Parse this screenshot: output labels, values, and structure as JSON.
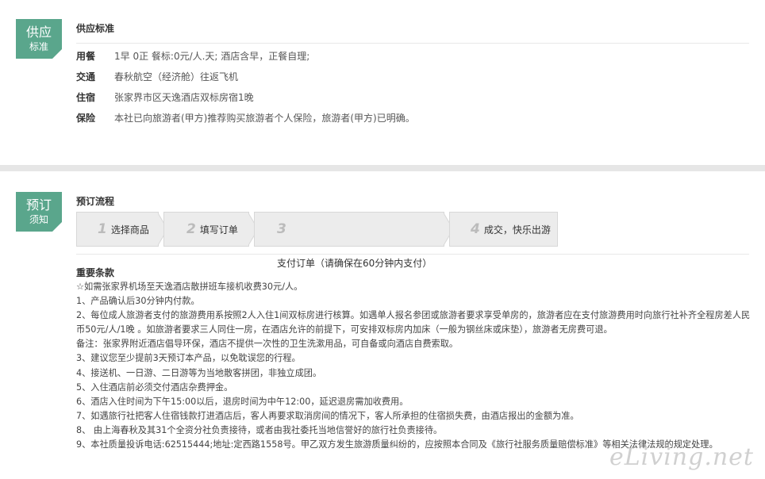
{
  "supply": {
    "badge_top": "供应",
    "badge_bottom": "标准",
    "title": "供应标准",
    "rows": [
      {
        "key": "用餐",
        "value": "1早 0正 餐标:0元/人.天; 酒店含早，正餐自理;"
      },
      {
        "key": "交通",
        "value": "春秋航空（经济舱）往返飞机"
      },
      {
        "key": "住宿",
        "value": "张家界市区天逸酒店双标房宿1晚"
      },
      {
        "key": "保险",
        "value": "本社已向旅游者(甲方)推荐购买旅游者个人保险，旅游者(甲方)已明确。"
      }
    ]
  },
  "booking": {
    "badge_top": "预订",
    "badge_bottom": "须知",
    "title": "预订流程",
    "steps": [
      {
        "num": "1",
        "label": "选择商品"
      },
      {
        "num": "2",
        "label": "填写订单"
      },
      {
        "num": "3",
        "label": "支付订单（请确保在60分钟内支付）"
      },
      {
        "num": "4",
        "label": "成交，快乐出游"
      }
    ],
    "terms_title": "重要条款",
    "terms": [
      "☆如需张家界机场至天逸酒店散拼班车接机收费30元/人。",
      "1、产品确认后30分钟内付款。",
      "2、每位成人旅游者支付的旅游费用系按照2人入住1间双标房进行核算。如遇单人报名参团或旅游者要求享受单房的，旅游者应在支付旅游费用时向旅行社补齐全程房差人民币50元/人/1晚 。如旅游者要求三人同住一房，在酒店允许的前提下，可安排双标房内加床（一般为钢丝床或床垫），旅游者无房费可退。",
      "备注：张家界附近酒店倡导环保，酒店不提供一次性的卫生洗漱用品，可自备或向酒店自费索取。",
      "3、建议您至少提前3天预订本产品，以免耽误您的行程。",
      "4、接送机、一日游、二日游等为当地散客拼团，非独立成团。",
      "5、入住酒店前必须交付酒店杂费押金。",
      "6、酒店入住时间为下午15:00以后，退房时间为中午12:00，延迟退房需加收费用。",
      "7、如遇旅行社把客人住宿钱款打进酒店后，客人再要求取消房间的情况下，客人所承担的住宿损失费，由酒店报出的金额为准。",
      "8、 由上海春秋及其31个全资分社负责接待，或者由我社委托当地信誉好的旅行社负责接待。",
      "9、本社质量投诉电话:62515444;地址:定西路1558号。甲乙双方发生旅游质量纠纷的，应按照本合同及《旅行社服务质量赔偿标准》等相关法律法规的规定处理。"
    ]
  },
  "watermark": "eLiving.net",
  "colors": {
    "accent": "#5aa68c",
    "step_bg": "#ececec",
    "page_bg": "#e6e6e6"
  }
}
